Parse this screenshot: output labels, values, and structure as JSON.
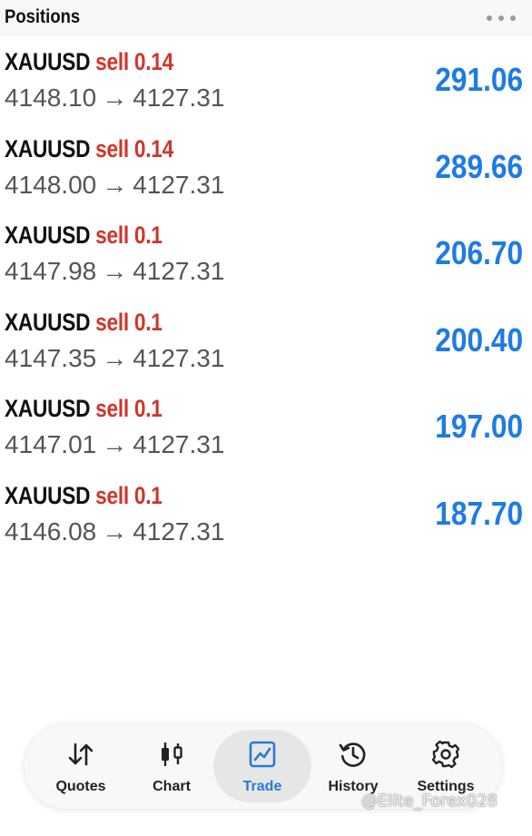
{
  "header": {
    "title": "Positions"
  },
  "positions": [
    {
      "symbol": "XAUUSD",
      "side": "sell",
      "volume": "0.14",
      "open_price": "4148.10",
      "current_price": "4127.31",
      "profit": "291.06"
    },
    {
      "symbol": "XAUUSD",
      "side": "sell",
      "volume": "0.14",
      "open_price": "4148.00",
      "current_price": "4127.31",
      "profit": "289.66"
    },
    {
      "symbol": "XAUUSD",
      "side": "sell",
      "volume": "0.1",
      "open_price": "4147.98",
      "current_price": "4127.31",
      "profit": "206.70"
    },
    {
      "symbol": "XAUUSD",
      "side": "sell",
      "volume": "0.1",
      "open_price": "4147.35",
      "current_price": "4127.31",
      "profit": "200.40"
    },
    {
      "symbol": "XAUUSD",
      "side": "sell",
      "volume": "0.1",
      "open_price": "4147.01",
      "current_price": "4127.31",
      "profit": "197.00"
    },
    {
      "symbol": "XAUUSD",
      "side": "sell",
      "volume": "0.1",
      "open_price": "4146.08",
      "current_price": "4127.31",
      "profit": "187.70"
    }
  ],
  "arrow_glyph": "→",
  "tabbar": {
    "tabs": [
      {
        "label": "Quotes",
        "icon": "quotes-arrows-icon",
        "active": false
      },
      {
        "label": "Chart",
        "icon": "candlestick-chart-icon",
        "active": false
      },
      {
        "label": "Trade",
        "icon": "trade-chart-icon",
        "active": true
      },
      {
        "label": "History",
        "icon": "history-clock-icon",
        "active": false
      },
      {
        "label": "Settings",
        "icon": "gear-icon",
        "active": false
      }
    ]
  },
  "watermark": "@Elite_Forex028",
  "colors": {
    "sell": "#d0352b",
    "profit": "#1e7be4",
    "active_tab": "#2a7ad6"
  }
}
